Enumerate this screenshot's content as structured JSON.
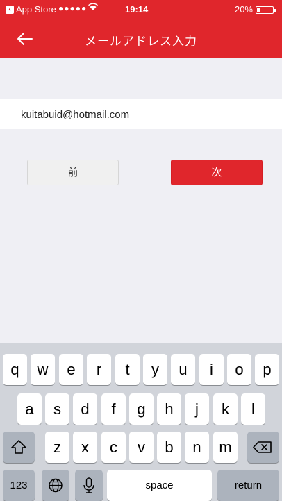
{
  "status_bar": {
    "back_app_label": "App Store",
    "signal": "●●●●●",
    "time": "19:14",
    "battery_percent": "20%",
    "battery_level": 0.2
  },
  "nav": {
    "title": "メールアドレス入力"
  },
  "email_field": {
    "value": "kuitabuid@hotmail.com"
  },
  "buttons": {
    "prev_label": "前",
    "next_label": "次"
  },
  "keyboard": {
    "row1": [
      "q",
      "w",
      "e",
      "r",
      "t",
      "y",
      "u",
      "i",
      "o",
      "p"
    ],
    "row2": [
      "a",
      "s",
      "d",
      "f",
      "g",
      "h",
      "j",
      "k",
      "l"
    ],
    "row3": [
      "z",
      "x",
      "c",
      "v",
      "b",
      "n",
      "m"
    ],
    "numbers_label": "123",
    "space_label": "space",
    "return_label": "return"
  },
  "colors": {
    "accent": "#e0262c",
    "background": "#efeff4",
    "keyboard_bg": "#d1d4da"
  }
}
